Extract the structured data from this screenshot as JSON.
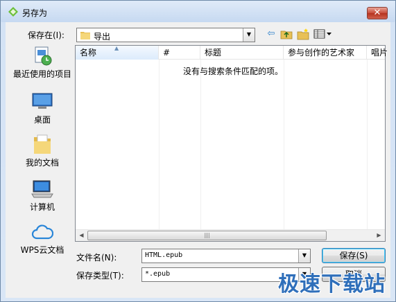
{
  "window": {
    "title": "另存为"
  },
  "toolbar": {
    "save_in_label": "保存在(I):",
    "current_folder": "导出"
  },
  "places": [
    {
      "label": "最近使用的项目",
      "icon": "recent-items-icon"
    },
    {
      "label": "桌面",
      "icon": "desktop-icon"
    },
    {
      "label": "我的文档",
      "icon": "documents-icon"
    },
    {
      "label": "计算机",
      "icon": "computer-icon"
    },
    {
      "label": "WPS云文档",
      "icon": "cloud-icon"
    }
  ],
  "list": {
    "columns": [
      "名称",
      "#",
      "标题",
      "参与创作的艺术家",
      "唱片"
    ],
    "empty_message": "没有与搜索条件匹配的项。"
  },
  "file_name": {
    "label": "文件名(N):",
    "value": "HTML.epub"
  },
  "file_type": {
    "label": "保存类型(T):",
    "value": "*.epub"
  },
  "buttons": {
    "save": "保存(S)",
    "cancel": "取消"
  },
  "watermark": "极速下载站",
  "colors": {
    "close": "#c74a38",
    "accent": "#2f6fba"
  }
}
